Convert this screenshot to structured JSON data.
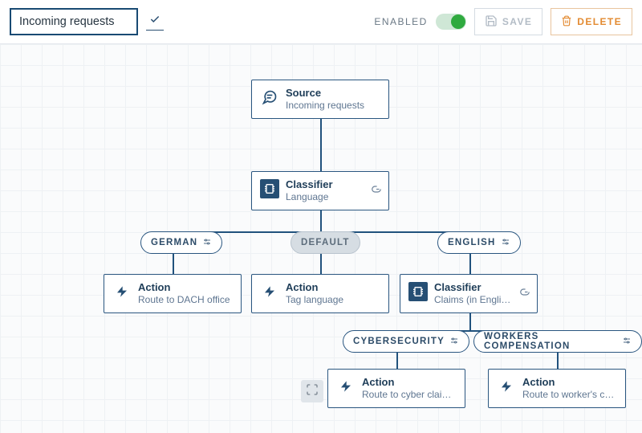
{
  "header": {
    "name_value": "Incoming requests",
    "enabled_label": "ENABLED",
    "enabled": true,
    "save_label": "SAVE",
    "delete_label": "DELETE"
  },
  "nodes": {
    "source": {
      "type_label": "Source",
      "subtitle": "Incoming requests"
    },
    "classifier_lang": {
      "type_label": "Classifier",
      "subtitle": "Language",
      "has_attachment": true
    },
    "action_dach": {
      "type_label": "Action",
      "subtitle": "Route to DACH office"
    },
    "action_tag": {
      "type_label": "Action",
      "subtitle": "Tag language"
    },
    "classifier_claims": {
      "type_label": "Classifier",
      "subtitle": "Claims (in English)",
      "has_attachment": true
    },
    "action_cyber": {
      "type_label": "Action",
      "subtitle": "Route to cyber claims of..."
    },
    "action_worker": {
      "type_label": "Action",
      "subtitle": "Route to worker's comp ..."
    }
  },
  "branches": {
    "german_label": "GERMAN",
    "default_label": "DEFAULT",
    "english_label": "ENGLISH",
    "cyber_label": "CYBERSECURITY",
    "workers_label": "WORKERS COMPENSATION"
  },
  "icons": {
    "source": "source-icon",
    "classifier": "classifier-icon",
    "action": "action-icon",
    "attachment": "attachment-icon",
    "sliders": "sliders-icon",
    "check": "check-icon",
    "save": "save-icon",
    "trash": "trash-icon",
    "fit": "fit-screen-icon"
  }
}
